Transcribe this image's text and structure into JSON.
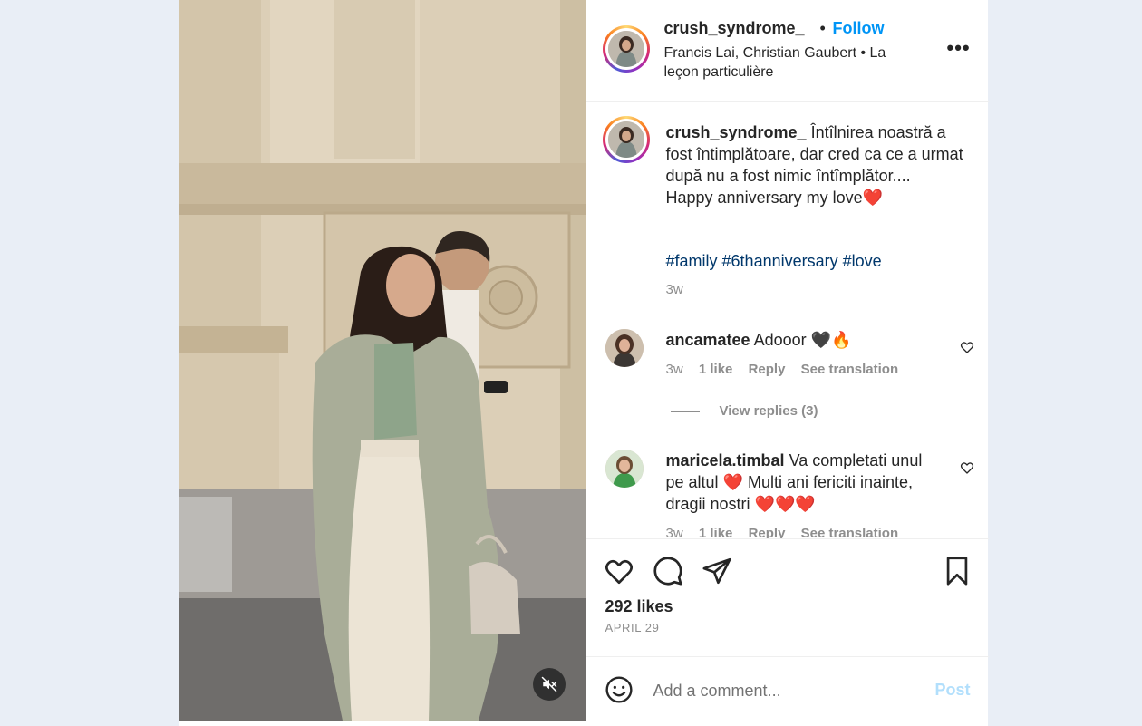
{
  "header": {
    "username": "crush_syndrome_",
    "separator": "•",
    "follow_label": "Follow",
    "audio_line": "Francis Lai, Christian Gaubert • La leçon particulière",
    "more_label": "•••"
  },
  "caption": {
    "username": "crush_syndrome_",
    "text_line1": "Întîlnirea noastră a fost întimplătoare, dar cred ca ce a urmat după nu a fost nimic întîmplător....",
    "text_line2": "Happy anniversary my love",
    "text_line2_emoji": "❤️",
    "hashtags": [
      "#family",
      "#6thanniversary",
      "#love"
    ],
    "time": "3w"
  },
  "comments": [
    {
      "username": "ancamatee",
      "text": "Adooor 🖤🔥",
      "time": "3w",
      "likes": "1 like",
      "reply_label": "Reply",
      "translate_label": "See translation"
    },
    {
      "username": "maricela.timbal",
      "text": "Va completati unul pe altul ❤️ Multi ani fericiti inainte, dragii nostri ❤️❤️❤️",
      "time": "3w",
      "likes": "1 like",
      "reply_label": "Reply",
      "translate_label": "See translation"
    }
  ],
  "view_replies_label": "View replies (3)",
  "footer": {
    "likes": "292 likes",
    "date": "APRIL 29"
  },
  "add_comment": {
    "placeholder": "Add a comment...",
    "post_label": "Post"
  },
  "icons": {
    "like": "heart-icon",
    "comment": "comment-icon",
    "share": "send-icon",
    "save": "bookmark-icon",
    "emoji": "emoji-icon",
    "mute": "speaker-muted-icon"
  },
  "colors": {
    "follow": "#0095f6",
    "hashtag": "#00376b",
    "post_disabled": "#b2dffc",
    "muted_text": "#8e8e8e"
  }
}
